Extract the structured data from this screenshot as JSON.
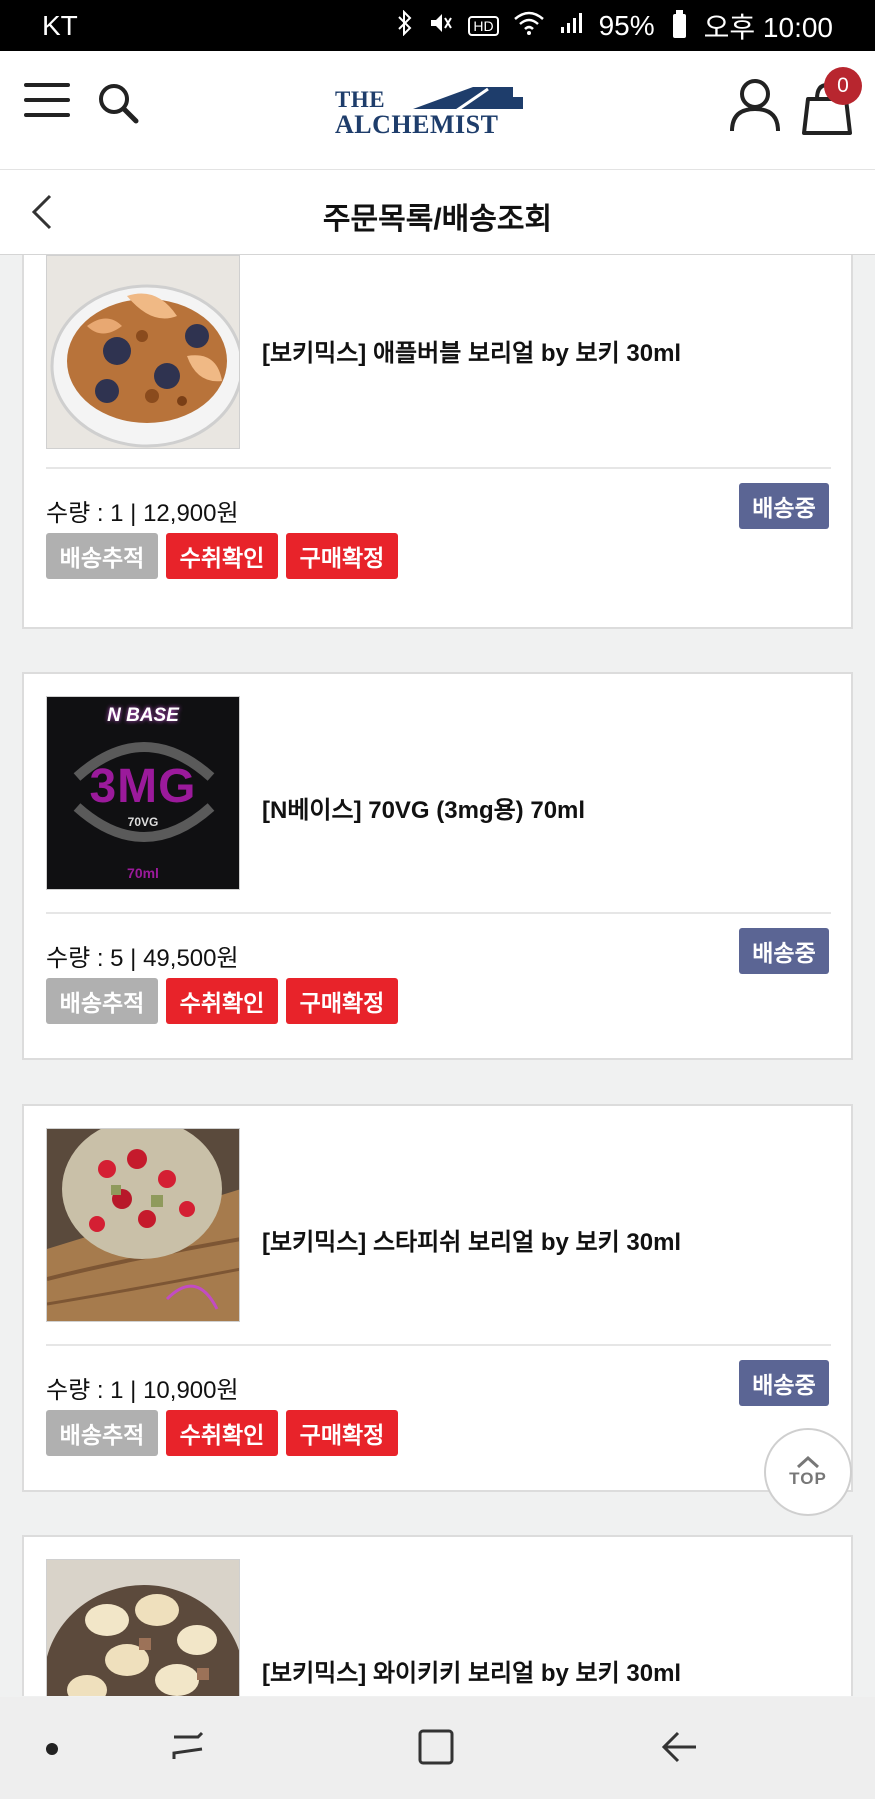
{
  "status_bar": {
    "carrier": "KT",
    "hd_label": "HD",
    "battery": "95%",
    "time": "오후 10:00"
  },
  "header": {
    "logo_line1": "THE",
    "logo_line2": "ALCHEMIST",
    "cart_count": "0"
  },
  "subheader": {
    "title": "주문목록/배송조회"
  },
  "orders": [
    {
      "name": "[보키믹스] 애플버블 보리얼 by 보키 30ml",
      "qty_text": "수량 : 1 | 12,900원",
      "status": "배송중",
      "btn_track": "배송추적",
      "btn_receive": "수취확인",
      "btn_confirm": "구매확정"
    },
    {
      "name": "[N베이스] 70VG (3mg용) 70ml",
      "qty_text": "수량 : 5 | 49,500원",
      "status": "배송중",
      "btn_track": "배송추적",
      "btn_receive": "수취확인",
      "btn_confirm": "구매확정",
      "thumb_text": {
        "top": "N BASE",
        "big": "3MG",
        "mid": "70VG",
        "bottom": "70ml"
      }
    },
    {
      "name": "[보키믹스] 스타피쉬 보리얼 by 보키 30ml",
      "qty_text": "수량 : 1 | 10,900원",
      "status": "배송중",
      "btn_track": "배송추적",
      "btn_receive": "수취확인",
      "btn_confirm": "구매확정"
    },
    {
      "name": "[보키믹스] 와이키키 보리얼 by 보키 30ml"
    }
  ],
  "top_button": {
    "label": "TOP"
  },
  "colors": {
    "status_badge": "#5b6594",
    "action_red": "#e8232a",
    "action_gray": "#b0b0b0",
    "brand_navy": "#1e3d6b",
    "cart_badge": "#b8262f"
  }
}
